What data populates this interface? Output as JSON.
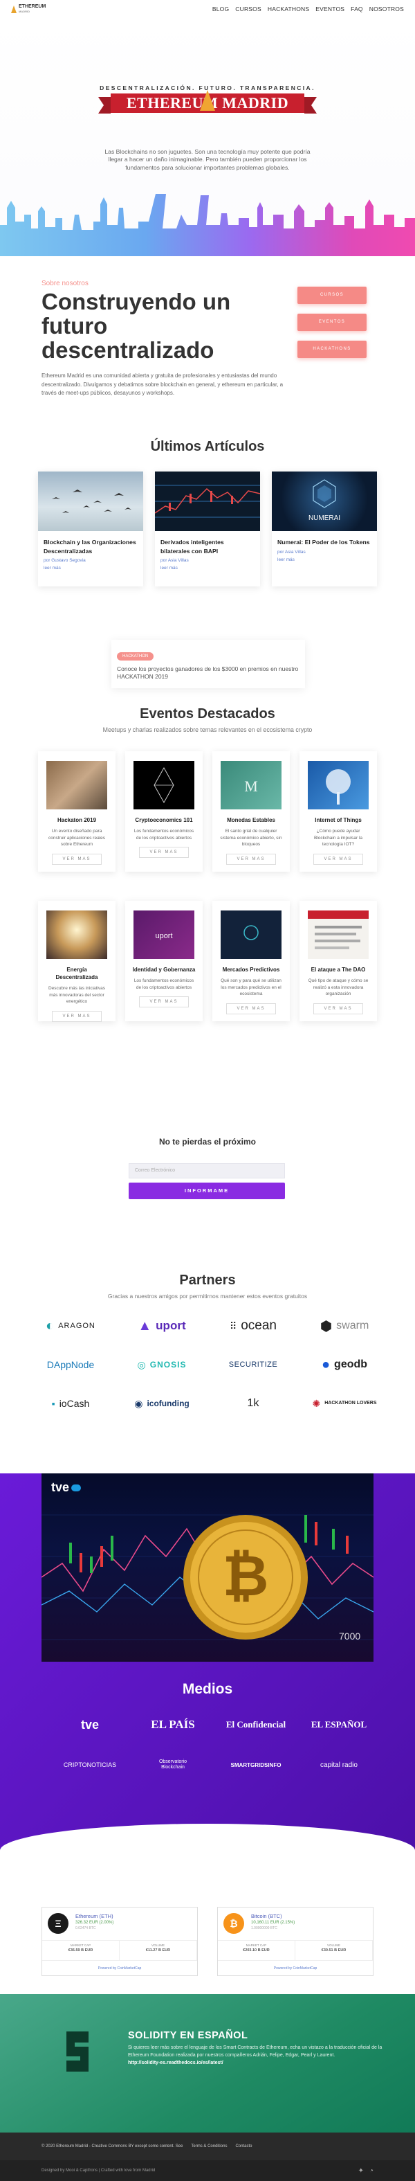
{
  "nav": {
    "logo_title": "ETHEREUM",
    "logo_sub": "MADRID",
    "items": [
      "BLOG",
      "CURSOS",
      "HACKATHONS",
      "EVENTOS",
      "FAQ",
      "NOSOTROS"
    ]
  },
  "hero": {
    "tagline": "DESCENTRALIZACIÓN. FUTURO. TRANSPARENCIA.",
    "brand": "ETHEREUM MADRID",
    "description": "Las Blockchains no son juguetes. Son una tecnología muy potente que podría llegar a hacer un daño inimaginable. Pero también pueden proporcionar los fundamentos para solucionar importantes problemas globales."
  },
  "about": {
    "eyebrow": "Sobre nosotros",
    "title": "Construyendo un futuro descentralizado",
    "text": "Ethereum Madrid es una comunidad abierta y gratuita de profesionales y entusiastas del mundo descentralizado. Divulgamos y debatimos sobre blockchain en general, y ethereum en particular, a través de meet-ups públicos, desayunos y workshops.",
    "buttons": [
      "CURSOS",
      "EVENTOS",
      "HACKATHONS"
    ]
  },
  "articles": {
    "title": "Últimos Artículos",
    "items": [
      {
        "title": "Blockchain y las Organizaciones Descentralizadas",
        "meta": "por Gustavo Segovia",
        "more": "leer más"
      },
      {
        "title": "Derivados inteligentes bilaterales con BAPI",
        "meta": "por Asia Villas",
        "more": "leer más"
      },
      {
        "title": "Numerai: El Poder de los Tokens",
        "meta": "por Asia Villas",
        "more": "leer más"
      }
    ]
  },
  "announcement": {
    "badge": "HACKATHON",
    "text": "Conoce los proyectos ganadores de los $3000 en premios en nuestro HACKATHON 2019"
  },
  "events": {
    "title": "Eventos Destacados",
    "subtitle": "Meetups y charlas realizados sobre temas relevantes en el ecosistema crypto",
    "button": "VER MAS",
    "items": [
      {
        "title": "Hackaton 2019",
        "desc": "Un evento diseñado para construir aplicaciones reales sobre Ethereum"
      },
      {
        "title": "Cryptoeconomics 101",
        "desc": "Los fundamentos económicos de los criptoactivos abiertos"
      },
      {
        "title": "Monedas Estables",
        "desc": "El santo grial de cualquier sistema económico abierto, sin bloqueos"
      },
      {
        "title": "Internet of Things",
        "desc": "¿Cómo puede ayudar Blockchain a impulsar la tecnología IOT?"
      },
      {
        "title": "Energía Descentralizada",
        "desc": "Descubre más las iniciativas más innovadoras del sector energético"
      },
      {
        "title": "Identidad y Gobernanza",
        "desc": "Los fundamentos económicos de los criptoactivos abiertos"
      },
      {
        "title": "Mercados Predictivos",
        "desc": "Qué son y para qué se utilizan los mercados predictivos en el ecosistema"
      },
      {
        "title": "El ataque a The DAO",
        "desc": "Qué tipo de ataque y cómo se realizó a esta innovadora organización"
      }
    ]
  },
  "newsletter": {
    "title": "No te pierdas el próximo",
    "placeholder": "Correo Electrónico",
    "button": "INFORMAME"
  },
  "partners": {
    "title": "Partners",
    "subtitle": "Gracias a nuestros amigos por permitirnos mantener estos eventos gratuitos",
    "logos": [
      "ARAGON",
      "uport",
      "ocean",
      "swarm",
      "DAppNode",
      "GNOSIS",
      "SECURITIZE",
      "geodb",
      "ioCash",
      "icofunding",
      "1k",
      "HACKATHON LOVERS"
    ]
  },
  "media": {
    "title": "Medios",
    "tve_badge": "tve",
    "logos": [
      "tve",
      "EL PAÍS",
      "El Confidencial",
      "EL ESPAÑOL",
      "CRIPTONOTICIAS",
      "Observatorio Blockchain",
      "SMARTGRIDSINFO",
      "capital radio"
    ]
  },
  "ticker": {
    "coins": [
      {
        "symbol": "Ξ",
        "name": "Ethereum (ETH)",
        "price": "326.32 EUR (2.00%)",
        "usd": "0.02474 BTC",
        "cap_label": "MARKET CAP",
        "cap": "€36.59 B EUR",
        "vol_label": "VOLUME",
        "vol": "€11.27 B EUR",
        "foot": "Powered by CoinMarketCap",
        "color": "#1a1a1a"
      },
      {
        "symbol": "₿",
        "name": "Bitcoin (BTC)",
        "price": "10,160.11 EUR (2.15%)",
        "usd": "1.00000000 BTC",
        "cap_label": "MARKET CAP",
        "cap": "€203.10 B EUR",
        "vol_label": "VOLUME",
        "vol": "€30.51 B EUR",
        "foot": "Powered by CoinMarketCap",
        "color": "#f7931a"
      }
    ]
  },
  "solidity": {
    "title": "SOLIDITY EN ESPAÑOL",
    "text": "Si quieres leer más sobre el lenguaje de los Smart Contracts de Ethereum, echa un vistazo a la traducción oficial de la Ethereum Foundation realizada por nuestros compañeros Adrián, Felipe, Edgar, Pearl y Laurent.",
    "link": "http://solidity-es.readthedocs.io/es/latest/"
  },
  "footer": {
    "copy": "© 2020 Ethereum Madrid - Creative Commons BY except some content. See",
    "links": [
      "Terms & Conditions",
      "Contacto"
    ],
    "credit": "Designed by Mooi & Capifrons | Crafted with love from Madrid"
  },
  "colors": {
    "accent": "#f58a86",
    "purple": "#8a2be2",
    "ribbon": "#c8202e",
    "green": "#1f8a63"
  }
}
